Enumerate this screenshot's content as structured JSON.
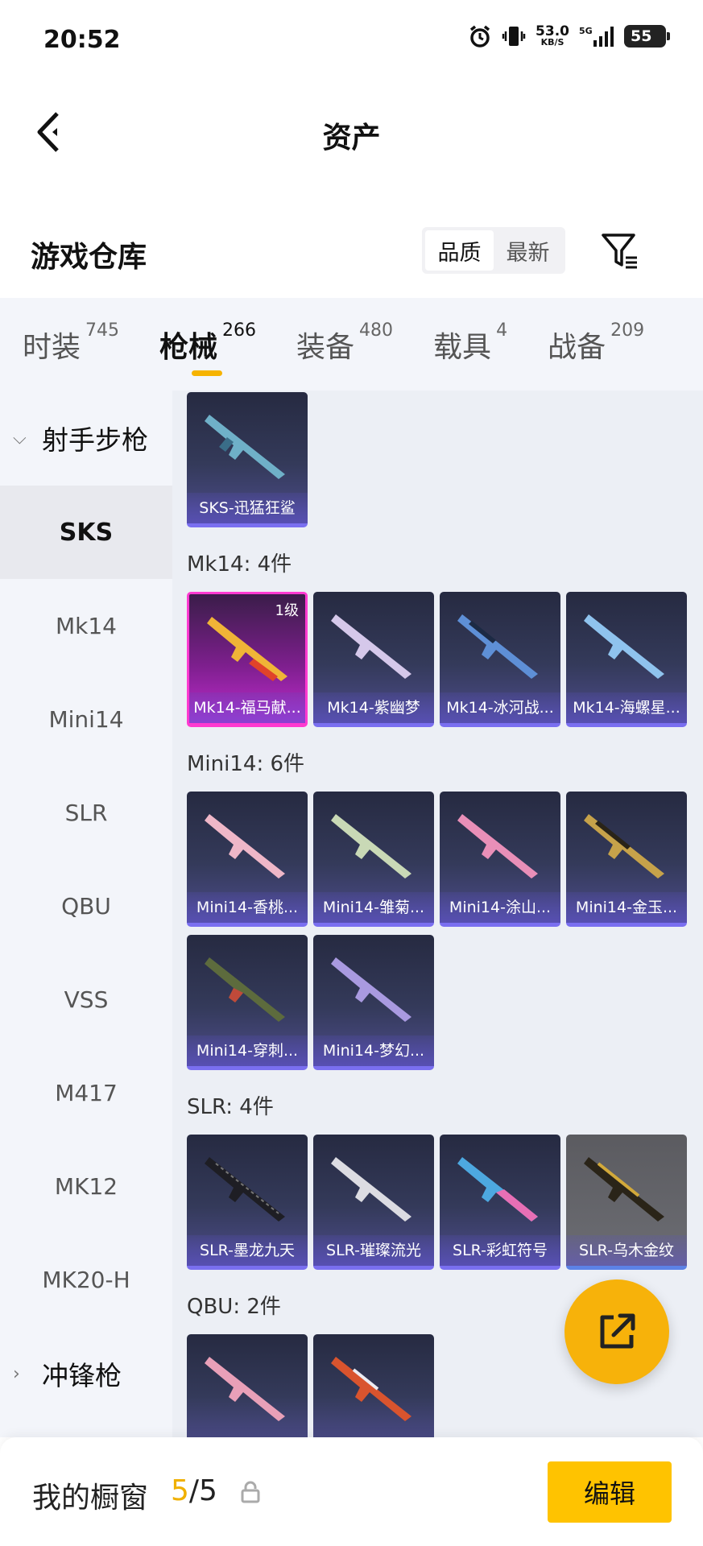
{
  "status_bar": {
    "time": "20:52",
    "net_speed": "53.0",
    "net_unit": "KB/S",
    "network": "5G",
    "battery": "55"
  },
  "nav": {
    "title": "资产",
    "back_icon": "back-arrow-icon"
  },
  "header": {
    "title": "游戏仓库",
    "sort_options": [
      "品质",
      "最新"
    ],
    "sort_selected": "品质",
    "filter_icon": "filter-icon"
  },
  "tabs": [
    {
      "label": "时装",
      "count": "745"
    },
    {
      "label": "枪械",
      "count": "266",
      "active": true
    },
    {
      "label": "装备",
      "count": "480"
    },
    {
      "label": "载具",
      "count": "4"
    },
    {
      "label": "战备",
      "count": "209"
    }
  ],
  "sidebar": {
    "group_expanded": "射手步枪",
    "items": [
      "SKS",
      "Mk14",
      "Mini14",
      "SLR",
      "QBU",
      "VSS",
      "M417",
      "MK12",
      "MK20-H"
    ],
    "active_item": "SKS",
    "group_collapsed": "冲锋枪"
  },
  "content": {
    "sections": [
      {
        "label": "",
        "items": [
          {
            "name": "SKS-迅猛狂鲨"
          }
        ]
      },
      {
        "label": "Mk14: 4件",
        "items": [
          {
            "name": "Mk14-福马献...",
            "level": "1级"
          },
          {
            "name": "Mk14-紫幽梦"
          },
          {
            "name": "Mk14-冰河战..."
          },
          {
            "name": "Mk14-海螺星..."
          }
        ]
      },
      {
        "label": "Mini14: 6件",
        "items": [
          {
            "name": "Mini14-香桃..."
          },
          {
            "name": "Mini14-雏菊..."
          },
          {
            "name": "Mini14-涂山..."
          },
          {
            "name": "Mini14-金玉..."
          },
          {
            "name": "Mini14-穿刺..."
          },
          {
            "name": "Mini14-梦幻..."
          }
        ]
      },
      {
        "label": "SLR: 4件",
        "items": [
          {
            "name": "SLR-墨龙九天"
          },
          {
            "name": "SLR-璀璨流光"
          },
          {
            "name": "SLR-彩虹符号"
          },
          {
            "name": "SLR-乌木金纹"
          }
        ]
      },
      {
        "label": "QBU: 2件",
        "items": []
      }
    ]
  },
  "bottom_bar": {
    "showcase_label": "我的橱窗",
    "showcase_current": "5",
    "showcase_sep": "/",
    "showcase_total": "5",
    "edit_label": "编辑"
  },
  "colors": {
    "accent": "#f6b300",
    "edit_button": "#ffc300",
    "fab": "#f7b20a",
    "card_rare": "#7a6ff0",
    "card_legendary": "#ff3ad0"
  }
}
